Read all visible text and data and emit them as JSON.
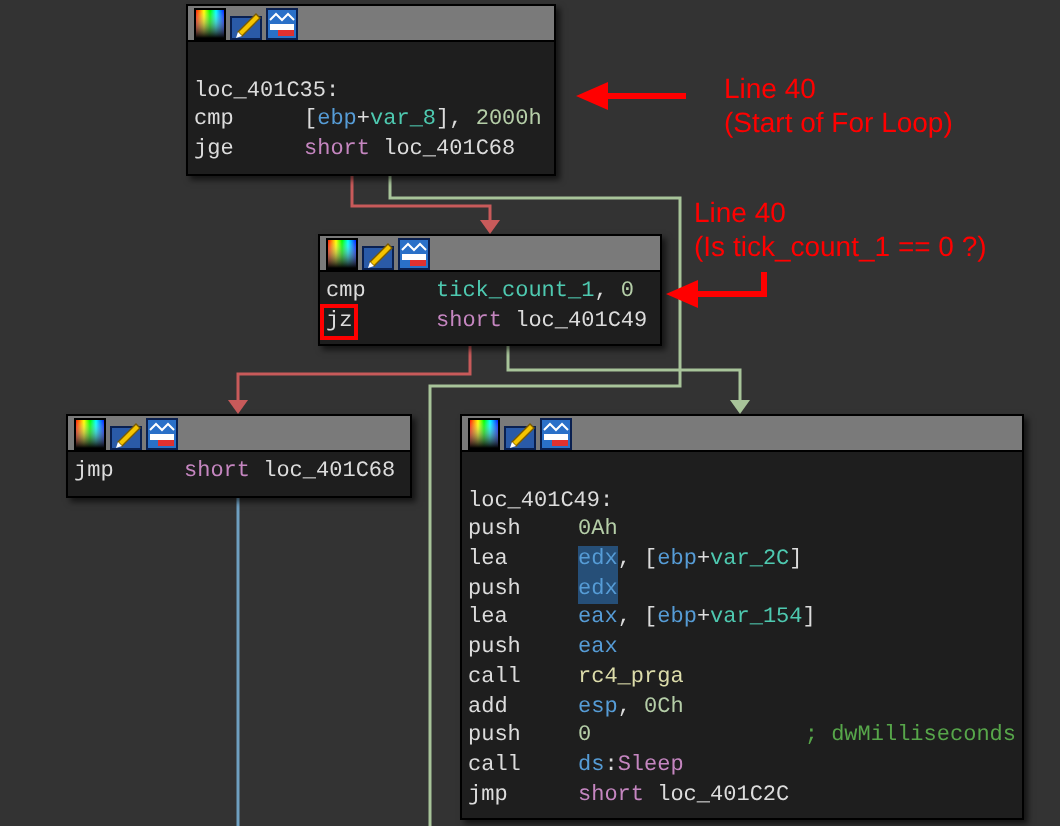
{
  "nodes": [
    {
      "lines": [
        {
          "kind": "blank"
        },
        {
          "kind": "label",
          "text": "loc_401C35:"
        },
        {
          "kind": "insn",
          "mnemonic": "cmp",
          "operands": [
            {
              "kind": "plain",
              "text": "["
            },
            {
              "kind": "reg",
              "text": "ebp"
            },
            {
              "kind": "plain",
              "text": "+"
            },
            {
              "kind": "var",
              "text": "var_8"
            },
            {
              "kind": "plain",
              "text": "], "
            },
            {
              "kind": "num",
              "text": "2000h"
            }
          ]
        },
        {
          "kind": "insn",
          "mnemonic": "jge",
          "operands": [
            {
              "kind": "kw",
              "text": "short "
            },
            {
              "kind": "plain",
              "text": "loc_401C68"
            }
          ]
        }
      ]
    },
    {
      "lines": [
        {
          "kind": "insn",
          "mnemonic": "cmp",
          "operands": [
            {
              "kind": "var",
              "text": "tick_count_1"
            },
            {
              "kind": "plain",
              "text": ", "
            },
            {
              "kind": "num",
              "text": "0"
            }
          ]
        },
        {
          "kind": "insn",
          "mnemonic": "jz",
          "boxed": true,
          "operands": [
            {
              "kind": "kw",
              "text": "short "
            },
            {
              "kind": "plain",
              "text": "loc_401C49"
            }
          ]
        }
      ]
    },
    {
      "lines": [
        {
          "kind": "insn",
          "mnemonic": "jmp",
          "operands": [
            {
              "kind": "kw",
              "text": "short "
            },
            {
              "kind": "plain",
              "text": "loc_401C68"
            }
          ]
        }
      ]
    },
    {
      "lines": [
        {
          "kind": "blank"
        },
        {
          "kind": "label",
          "text": "loc_401C49:"
        },
        {
          "kind": "insn",
          "mnemonic": "push",
          "operands": [
            {
              "kind": "num",
              "text": "0Ah"
            }
          ]
        },
        {
          "kind": "insn",
          "mnemonic": "lea",
          "operands": [
            {
              "kind": "reg",
              "text": "edx",
              "highlighted": true
            },
            {
              "kind": "plain",
              "text": ", ["
            },
            {
              "kind": "reg",
              "text": "ebp"
            },
            {
              "kind": "plain",
              "text": "+"
            },
            {
              "kind": "var",
              "text": "var_2C"
            },
            {
              "kind": "plain",
              "text": "]"
            }
          ]
        },
        {
          "kind": "insn",
          "mnemonic": "push",
          "operands": [
            {
              "kind": "reg",
              "text": "edx",
              "highlighted": true
            }
          ]
        },
        {
          "kind": "insn",
          "mnemonic": "lea",
          "operands": [
            {
              "kind": "reg",
              "text": "eax"
            },
            {
              "kind": "plain",
              "text": ", ["
            },
            {
              "kind": "reg",
              "text": "ebp"
            },
            {
              "kind": "plain",
              "text": "+"
            },
            {
              "kind": "var",
              "text": "var_154"
            },
            {
              "kind": "plain",
              "text": "]"
            }
          ]
        },
        {
          "kind": "insn",
          "mnemonic": "push",
          "operands": [
            {
              "kind": "reg",
              "text": "eax"
            }
          ]
        },
        {
          "kind": "insn",
          "mnemonic": "call",
          "operands": [
            {
              "kind": "func",
              "text": "rc4_prga"
            }
          ]
        },
        {
          "kind": "insn",
          "mnemonic": "add",
          "operands": [
            {
              "kind": "reg",
              "text": "esp"
            },
            {
              "kind": "plain",
              "text": ", "
            },
            {
              "kind": "num",
              "text": "0Ch"
            }
          ]
        },
        {
          "kind": "insn",
          "mnemonic": "push",
          "operands": [
            {
              "kind": "num",
              "text": "0"
            },
            {
              "kind": "comment",
              "text": "; dwMilliseconds"
            }
          ]
        },
        {
          "kind": "insn",
          "mnemonic": "call",
          "operands": [
            {
              "kind": "reg",
              "text": "ds"
            },
            {
              "kind": "plain",
              "text": ":"
            },
            {
              "kind": "kw",
              "text": "Sleep"
            }
          ]
        },
        {
          "kind": "insn",
          "mnemonic": "jmp",
          "operands": [
            {
              "kind": "kw",
              "text": "short "
            },
            {
              "kind": "plain",
              "text": "loc_401C2C"
            }
          ]
        }
      ]
    }
  ],
  "annotations": [
    {
      "lines": [
        "Line 40",
        "(Start of For Loop)"
      ]
    },
    {
      "lines": [
        "Line 40",
        "(Is tick_count_1 == 0 ?)"
      ]
    }
  ]
}
